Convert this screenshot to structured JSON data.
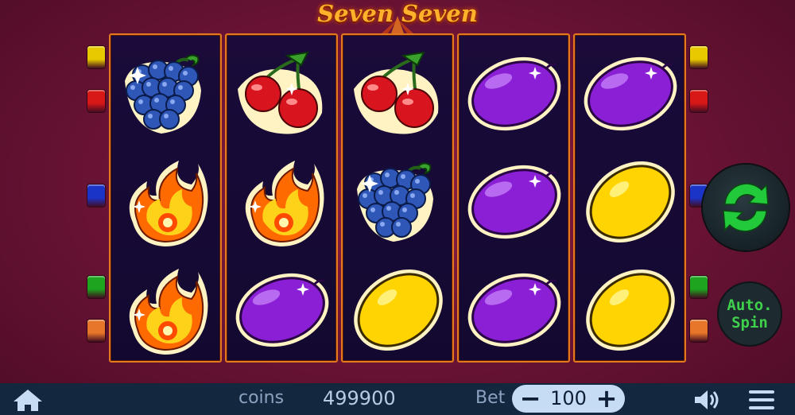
{
  "title": "Seven Seven",
  "reels": [
    [
      "grapes-icon",
      "flame-icon",
      "flame-icon"
    ],
    [
      "cherry-icon",
      "flame-icon",
      "plum-icon"
    ],
    [
      "cherry-icon",
      "grapes-icon",
      "lemon-icon"
    ],
    [
      "plum-icon",
      "plum-icon",
      "plum-icon"
    ],
    [
      "plum-icon",
      "lemon-icon",
      "lemon-icon"
    ]
  ],
  "paylines": {
    "left": [
      "#e8c900",
      "#d81717",
      "#1b34c8",
      "#1fa420",
      "#e7762a"
    ],
    "right": [
      "#e8c900",
      "#d81717",
      "#1b34c8",
      "#1fa420",
      "#e7762a"
    ]
  },
  "spin_icon": "refresh-icon",
  "auto_spin": {
    "line1": "Auto.",
    "line2": "Spin"
  },
  "bottom_bar": {
    "home_icon": "home-icon",
    "coins_label": "coins",
    "coins_value": "499900",
    "bet_label": "Bet",
    "bet_value": "100",
    "minus_label": "−",
    "plus_label": "+",
    "sound_icon": "speaker-icon",
    "menu_icon": "hamburger-menu-icon"
  },
  "colors": {
    "reel_border": "#e47a20",
    "spin_arrow": "#22c93a",
    "bottom_bar": "#13273f"
  }
}
